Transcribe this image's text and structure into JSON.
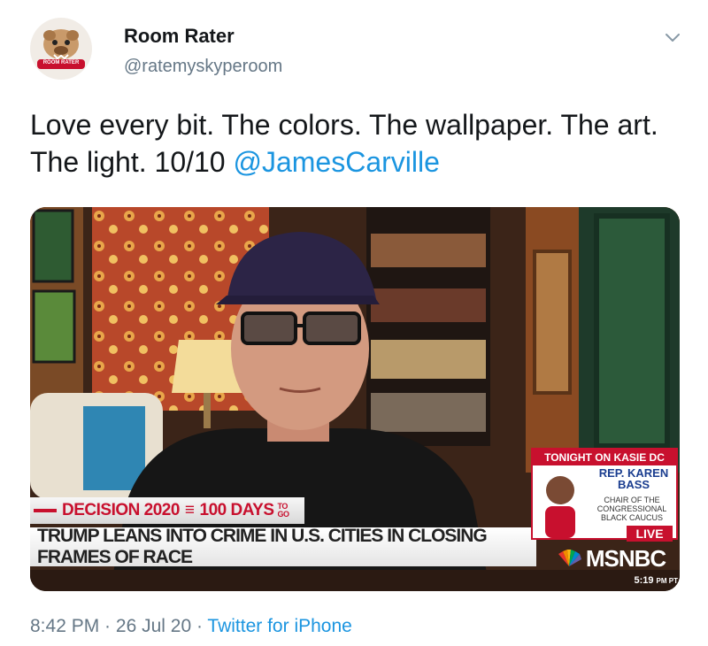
{
  "author": {
    "name": "Room Rater",
    "handle": "@ratemyskyperoom",
    "avatar_text": "ROOM RATER",
    "avatar_icon": "bulldog-logo"
  },
  "menu_icon": "chevron-down-icon",
  "tweet": {
    "text": "Love every bit. The colors. The wallpaper. The art. The light. 10/10 ",
    "mention": "@JamesCarville"
  },
  "media": {
    "description_icon": "tv-screen-photo",
    "chyron_top": "DECISION 2020",
    "chyron_days": "100 DAYS",
    "chyron_days_suffix": "TO GO",
    "chyron_main": "TRUMP LEANS INTO CRIME IN U.S. CITIES IN CLOSING FRAMES OF RACE",
    "promo_header": "TONIGHT ON KASIE DC",
    "promo_name": "REP. KAREN BASS",
    "promo_sub": "CHAIR OF THE CONGRESSIONAL BLACK CAUCUS",
    "live": "LIVE",
    "network": "MSNBC",
    "clock": "5:19",
    "clock_suffix": "PM PT"
  },
  "footer": {
    "time": "8:42 PM",
    "sep1": " · ",
    "date": "26 Jul 20",
    "sep2": " · ",
    "source": "Twitter for iPhone"
  },
  "colors": {
    "link": "#1b95e0",
    "muted": "#657786",
    "msnbc_red": "#c8102e"
  }
}
